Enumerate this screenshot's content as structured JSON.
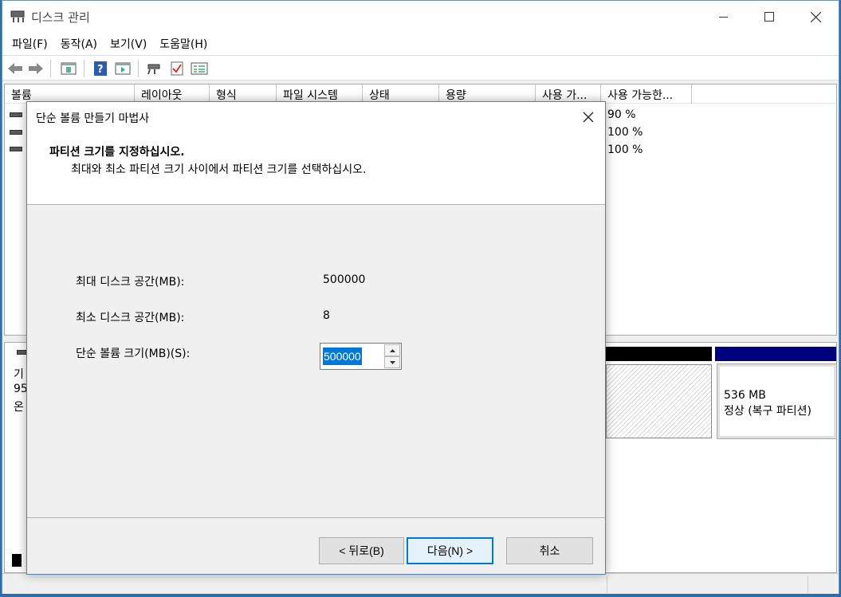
{
  "window": {
    "title": "디스크 관리"
  },
  "menu": {
    "items": [
      "파일(F)",
      "동작(A)",
      "보기(V)",
      "도움말(H)"
    ]
  },
  "toolbar": {
    "icons": [
      "back-arrow-icon",
      "forward-arrow-icon",
      "properties-panel-icon",
      "help-icon",
      "console-tree-icon",
      "connect-icon",
      "checklist-icon",
      "volume-list-icon"
    ]
  },
  "volume_list": {
    "columns": [
      "볼륨",
      "레이아웃",
      "형식",
      "파일 시스템",
      "상태",
      "용량",
      "사용 가...",
      "사용 가능한..."
    ],
    "rows": [
      {
        "free_pct": "90 %"
      },
      {
        "free_pct": "100 %"
      },
      {
        "free_pct": "100 %"
      }
    ]
  },
  "graphical": {
    "disk_label_partial": [
      "기",
      "95",
      "온"
    ],
    "recovery_partition": {
      "size": "536 MB",
      "status": "정상 (복구 파티션)"
    }
  },
  "dialog": {
    "title": "단순 볼륨 만들기 마법사",
    "heading": "파티션 크기를 지정하십시오.",
    "subheading": "최대와 최소 파티션 크기 사이에서 파티션 크기를 선택하십시오.",
    "max_label": "최대 디스크 공간(MB):",
    "max_value": "500000",
    "min_label": "최소 디스크 공간(MB):",
    "min_value": "8",
    "size_label": "단순 볼륨 크기(MB)(S):",
    "size_value": "500000",
    "buttons": {
      "back": "< 뒤로(B)",
      "next": "다음(N) >",
      "cancel": "취소"
    }
  }
}
